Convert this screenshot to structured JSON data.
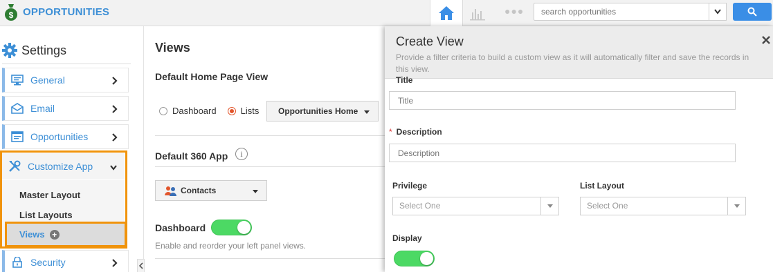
{
  "app": {
    "title": "OPPORTUNITIES"
  },
  "header": {
    "nav": {
      "home_icon": "home-icon",
      "chart_icon": "bar-chart-icon",
      "more_icon": "more-dots-icon"
    },
    "search": {
      "placeholder": "search opportunities",
      "search_icon": "search-icon"
    }
  },
  "sidebar": {
    "title": "Settings",
    "items": [
      {
        "label": "General",
        "icon": "monitor-icon"
      },
      {
        "label": "Email",
        "icon": "envelope-icon"
      },
      {
        "label": "Opportunities",
        "icon": "list-icon"
      }
    ],
    "customize": {
      "label": "Customize App",
      "icon": "tools-icon",
      "subitems": [
        "Master Layout",
        "List Layouts",
        "Views"
      ]
    },
    "security": {
      "label": "Security",
      "icon": "lock-icon"
    }
  },
  "main": {
    "title": "Views",
    "home_page_view": {
      "title": "Default Home Page View",
      "options": [
        "Dashboard",
        "Lists"
      ],
      "selected": "Lists",
      "dropdown_value": "Opportunities Home"
    },
    "app_360": {
      "title": "Default 360 App",
      "info_glyph": "i",
      "dropdown_value": "Contacts"
    },
    "dashboard": {
      "label": "Dashboard",
      "enabled": true,
      "hint": "Enable and reorder your left panel views."
    }
  },
  "create_view": {
    "title": "Create View",
    "description": "Provide a filter criteria to build a custom view as it will automatically filter and save the records in this view.",
    "title_field": {
      "label": "Title",
      "placeholder": "Title"
    },
    "description_field": {
      "required_mark": "*",
      "label": "Description",
      "placeholder": "Description"
    },
    "privilege": {
      "label": "Privilege",
      "value": "Select One"
    },
    "list_layout": {
      "label": "List Layout",
      "value": "Select One"
    },
    "display": {
      "label": "Display",
      "enabled": true
    }
  },
  "colors": {
    "accent": "#3d8fd6",
    "highlight_border": "#f0930b",
    "search_button": "#3a8ee6",
    "toggle_on": "#4cd964",
    "required": "#d9302f"
  }
}
